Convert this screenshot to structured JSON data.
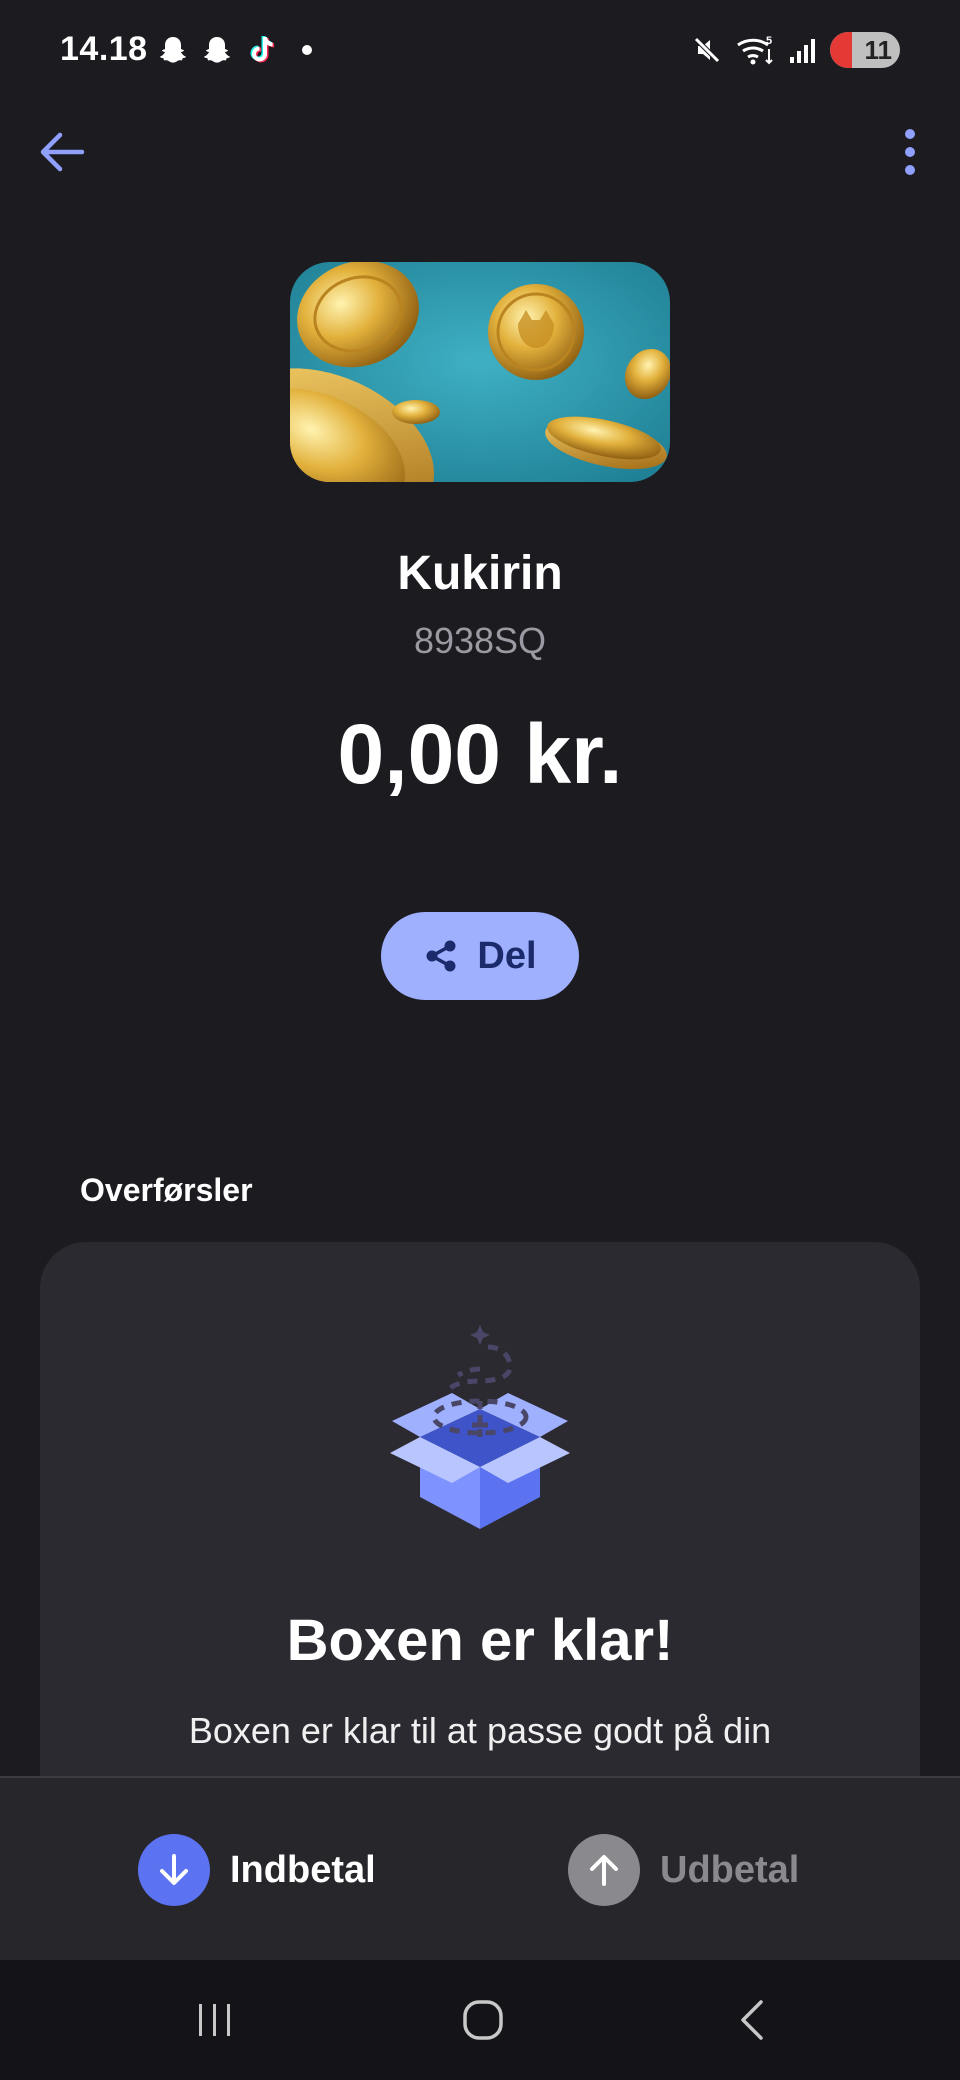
{
  "status_bar": {
    "time": "14.18",
    "battery": "11",
    "network_label": "5"
  },
  "top_bar": {
    "back_icon": "arrow-left-icon",
    "more_icon": "more-vert-icon"
  },
  "box": {
    "name": "Kukirin",
    "code": "8938SQ",
    "amount": "0,00 kr.",
    "share_label": "Del"
  },
  "transfers": {
    "section_title": "Overførsler",
    "empty_title": "Boxen er klar!",
    "empty_text": "Boxen er klar til at passe godt på din"
  },
  "actions": {
    "deposit_label": "Indbetal",
    "withdraw_label": "Udbetal"
  },
  "colors": {
    "background": "#1c1b20",
    "accent": "#9fb0ff",
    "deposit": "#5b73f0",
    "disabled": "#8a8a8e",
    "card": "#2b2a30"
  }
}
